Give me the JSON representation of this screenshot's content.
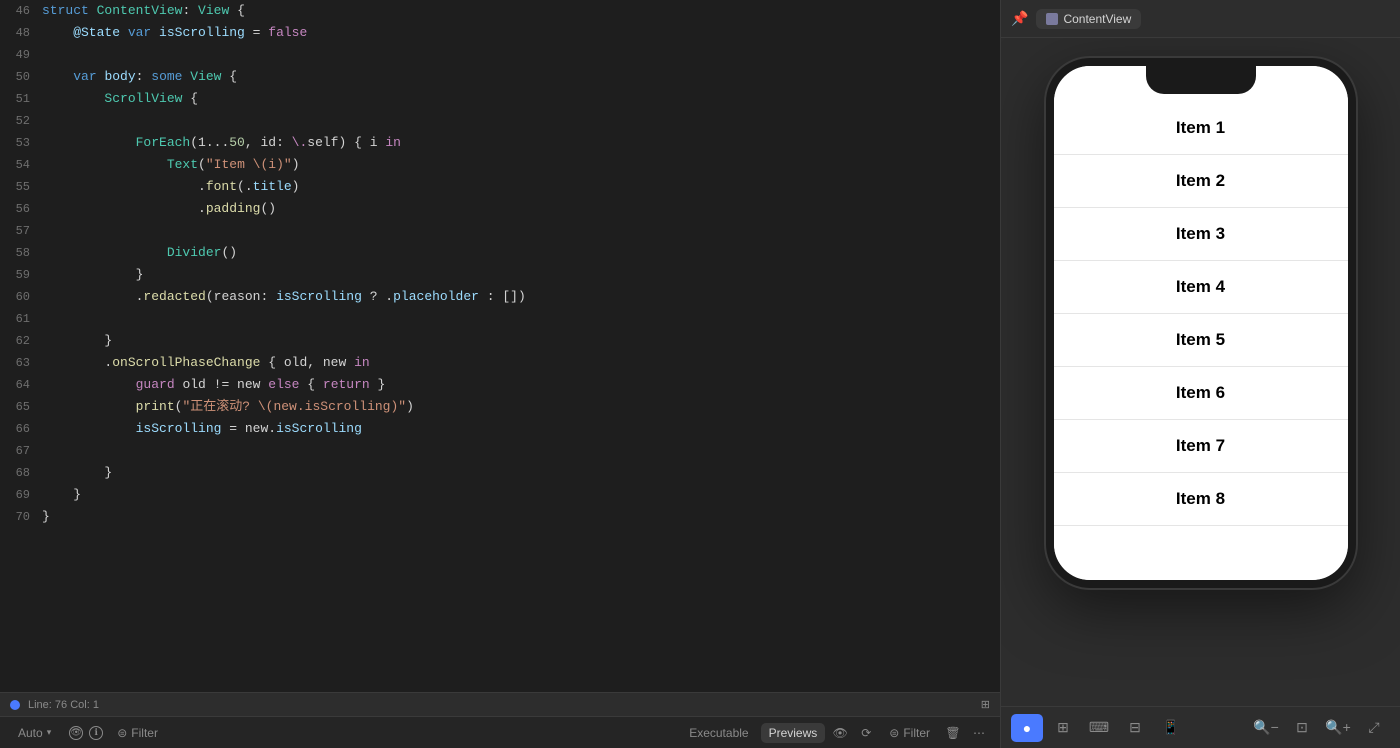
{
  "header": {
    "contentview_label": "ContentView"
  },
  "code": {
    "lines": [
      {
        "num": "46",
        "tokens": [
          {
            "text": "struct ",
            "cls": "kw-blue"
          },
          {
            "text": "ContentView",
            "cls": "kw-type"
          },
          {
            "text": ": ",
            "cls": "kw-plain"
          },
          {
            "text": "View",
            "cls": "kw-type"
          },
          {
            "text": " {",
            "cls": "kw-plain"
          }
        ]
      },
      {
        "num": "48",
        "tokens": [
          {
            "text": "    @State ",
            "cls": "kw-prop"
          },
          {
            "text": "var ",
            "cls": "kw-blue"
          },
          {
            "text": "isScrolling",
            "cls": "kw-prop"
          },
          {
            "text": " = ",
            "cls": "kw-plain"
          },
          {
            "text": "false",
            "cls": "kw-pink"
          }
        ]
      },
      {
        "num": "49",
        "tokens": []
      },
      {
        "num": "50",
        "tokens": [
          {
            "text": "    ",
            "cls": ""
          },
          {
            "text": "var ",
            "cls": "kw-blue"
          },
          {
            "text": "body",
            "cls": "kw-body"
          },
          {
            "text": ": ",
            "cls": "kw-plain"
          },
          {
            "text": "some ",
            "cls": "kw-blue"
          },
          {
            "text": "View",
            "cls": "kw-type"
          },
          {
            "text": " {",
            "cls": "kw-plain"
          }
        ]
      },
      {
        "num": "51",
        "tokens": [
          {
            "text": "        ",
            "cls": ""
          },
          {
            "text": "ScrollView",
            "cls": "kw-type"
          },
          {
            "text": " {",
            "cls": "kw-plain"
          }
        ]
      },
      {
        "num": "52",
        "tokens": []
      },
      {
        "num": "53",
        "tokens": [
          {
            "text": "            ",
            "cls": ""
          },
          {
            "text": "ForEach",
            "cls": "kw-type"
          },
          {
            "text": "(1...",
            "cls": "kw-plain"
          },
          {
            "text": "50",
            "cls": "kw-number"
          },
          {
            "text": ", id: ",
            "cls": "kw-plain"
          },
          {
            "text": "\\.",
            "cls": "kw-pink"
          },
          {
            "text": "self",
            "cls": "kw-plain"
          },
          {
            "text": ") { i ",
            "cls": "kw-plain"
          },
          {
            "text": "in",
            "cls": "kw-pink"
          }
        ]
      },
      {
        "num": "54",
        "tokens": [
          {
            "text": "                ",
            "cls": ""
          },
          {
            "text": "Text",
            "cls": "kw-type"
          },
          {
            "text": "(",
            "cls": "kw-plain"
          },
          {
            "text": "\"Item \\(i)\"",
            "cls": "kw-string"
          },
          {
            "text": ")",
            "cls": "kw-plain"
          }
        ]
      },
      {
        "num": "55",
        "tokens": [
          {
            "text": "                    .",
            "cls": "kw-plain"
          },
          {
            "text": "font",
            "cls": "kw-method"
          },
          {
            "text": "(.",
            "cls": "kw-plain"
          },
          {
            "text": "title",
            "cls": "kw-prop"
          },
          {
            "text": ")",
            "cls": "kw-plain"
          }
        ]
      },
      {
        "num": "56",
        "tokens": [
          {
            "text": "                    .",
            "cls": "kw-plain"
          },
          {
            "text": "padding",
            "cls": "kw-method"
          },
          {
            "text": "()",
            "cls": "kw-plain"
          }
        ]
      },
      {
        "num": "57",
        "tokens": []
      },
      {
        "num": "58",
        "tokens": [
          {
            "text": "                ",
            "cls": ""
          },
          {
            "text": "Divider",
            "cls": "kw-type"
          },
          {
            "text": "()",
            "cls": "kw-plain"
          }
        ]
      },
      {
        "num": "59",
        "tokens": [
          {
            "text": "            }",
            "cls": "kw-plain"
          }
        ]
      },
      {
        "num": "60",
        "tokens": [
          {
            "text": "            .",
            "cls": "kw-plain"
          },
          {
            "text": "redacted",
            "cls": "kw-method"
          },
          {
            "text": "(reason: ",
            "cls": "kw-plain"
          },
          {
            "text": "isScrolling",
            "cls": "kw-prop"
          },
          {
            "text": " ? .",
            "cls": "kw-plain"
          },
          {
            "text": "placeholder",
            "cls": "kw-prop"
          },
          {
            "text": " : [])",
            "cls": "kw-plain"
          }
        ]
      },
      {
        "num": "61",
        "tokens": []
      },
      {
        "num": "62",
        "tokens": [
          {
            "text": "        }",
            "cls": "kw-plain"
          }
        ]
      },
      {
        "num": "63",
        "tokens": [
          {
            "text": "        .",
            "cls": "kw-plain"
          },
          {
            "text": "onScrollPhaseChange",
            "cls": "kw-method"
          },
          {
            "text": " { old, new ",
            "cls": "kw-plain"
          },
          {
            "text": "in",
            "cls": "kw-pink"
          }
        ]
      },
      {
        "num": "64",
        "tokens": [
          {
            "text": "            ",
            "cls": ""
          },
          {
            "text": "guard",
            "cls": "kw-guard"
          },
          {
            "text": " old != new ",
            "cls": "kw-plain"
          },
          {
            "text": "else",
            "cls": "kw-pink"
          },
          {
            "text": " { ",
            "cls": "kw-plain"
          },
          {
            "text": "return",
            "cls": "kw-pink"
          },
          {
            "text": " }",
            "cls": "kw-plain"
          }
        ]
      },
      {
        "num": "65",
        "tokens": [
          {
            "text": "            ",
            "cls": ""
          },
          {
            "text": "print",
            "cls": "kw-method"
          },
          {
            "text": "(",
            "cls": "kw-plain"
          },
          {
            "text": "\"正在滚动? \\(new.isScrolling)\"",
            "cls": "kw-string"
          },
          {
            "text": ")",
            "cls": "kw-plain"
          }
        ]
      },
      {
        "num": "66",
        "tokens": [
          {
            "text": "            ",
            "cls": ""
          },
          {
            "text": "isScrolling",
            "cls": "kw-prop"
          },
          {
            "text": " = new.",
            "cls": "kw-plain"
          },
          {
            "text": "isScrolling",
            "cls": "kw-prop"
          }
        ]
      },
      {
        "num": "67",
        "tokens": []
      },
      {
        "num": "68",
        "tokens": [
          {
            "text": "        }",
            "cls": "kw-plain"
          }
        ]
      },
      {
        "num": "69",
        "tokens": [
          {
            "text": "    }",
            "cls": "kw-plain"
          }
        ]
      },
      {
        "num": "70",
        "tokens": [
          {
            "text": "}",
            "cls": "kw-plain"
          }
        ]
      }
    ]
  },
  "preview": {
    "title": "ContentView",
    "items": [
      "Item 1",
      "Item 2",
      "Item 3",
      "Item 4",
      "Item 5",
      "Item 6",
      "Item 7",
      "Item 8"
    ]
  },
  "toolbar": {
    "left_buttons": [
      "circle",
      "grid",
      "keyboard",
      "device",
      "phone"
    ],
    "right_buttons": [
      "zoom-out",
      "zoom-fit",
      "zoom-in",
      "zoom-full"
    ]
  },
  "status_bar": {
    "line_col": "Line: 76  Col: 1"
  },
  "bottom_tabs": {
    "left": [
      {
        "label": "Auto",
        "active": false
      },
      {
        "label": "Filter",
        "active": false
      }
    ],
    "right_tabs": [
      {
        "label": "Executable",
        "active": false
      },
      {
        "label": "Previews",
        "active": true
      }
    ]
  }
}
